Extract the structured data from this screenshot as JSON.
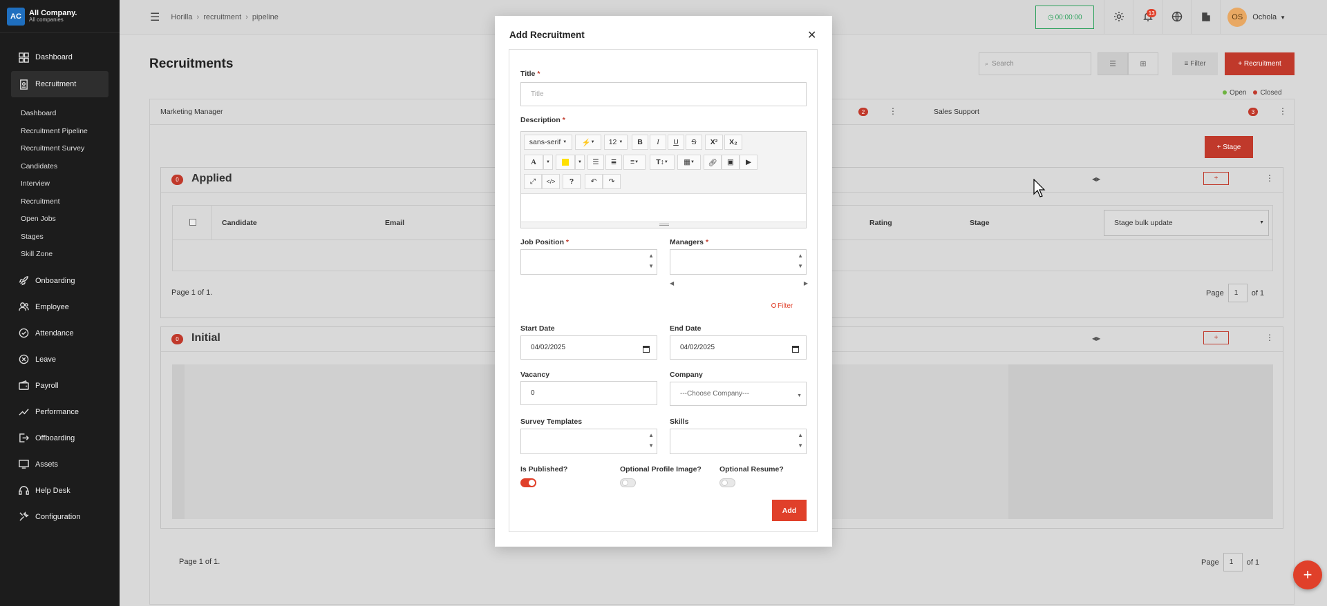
{
  "brand": {
    "initials": "AC",
    "name": "All Company.",
    "sub": "All companies"
  },
  "sidebar": {
    "items": [
      {
        "label": "Dashboard",
        "icon": "dashboard-icon"
      },
      {
        "label": "Recruitment",
        "icon": "recruitment-icon"
      },
      {
        "label": "Onboarding",
        "icon": "rocket-icon"
      },
      {
        "label": "Employee",
        "icon": "people-icon"
      },
      {
        "label": "Attendance",
        "icon": "check-circle-icon"
      },
      {
        "label": "Leave",
        "icon": "leave-icon"
      },
      {
        "label": "Payroll",
        "icon": "wallet-icon"
      },
      {
        "label": "Performance",
        "icon": "chart-line-icon"
      },
      {
        "label": "Offboarding",
        "icon": "exit-icon"
      },
      {
        "label": "Assets",
        "icon": "monitor-icon"
      },
      {
        "label": "Help Desk",
        "icon": "headset-icon"
      },
      {
        "label": "Configuration",
        "icon": "wrench-icon"
      }
    ],
    "subitems": [
      "Dashboard",
      "Recruitment Pipeline",
      "Recruitment Survey",
      "Candidates",
      "Interview",
      "Recruitment",
      "Open Jobs",
      "Stages",
      "Skill Zone"
    ]
  },
  "topbar": {
    "breadcrumb": [
      "Horilla",
      "recruitment",
      "pipeline"
    ],
    "timer": "00:00:00",
    "notifications": "13",
    "user_initials": "OS",
    "user_name": "Ochola"
  },
  "page": {
    "title": "Recruitments",
    "search_placeholder": "Search",
    "filter_label": "Filter",
    "add_recruitment_label": "+ Recruitment",
    "legend_open": "Open",
    "legend_closed": "Closed",
    "open_color": "#6db33f",
    "closed_color": "#c0392b",
    "tabs": [
      {
        "label": "Marketing Manager"
      },
      {
        "label": "",
        "count": "2"
      },
      {
        "label": "Sales Support",
        "count": "3"
      }
    ],
    "stage_button": "+ Stage",
    "stages": [
      {
        "name": "Applied",
        "count": "0",
        "add": "+"
      },
      {
        "name": "Initial",
        "count": "0",
        "add": "+"
      }
    ],
    "table_headers": [
      "Candidate",
      "Email",
      "Rating",
      "Stage"
    ],
    "bulk_update": "Stage bulk update",
    "pager": {
      "text": "Page 1 of 1.",
      "page_label": "Page",
      "page_value": "1",
      "of_label": "of 1"
    }
  },
  "modal": {
    "title": "Add Recruitment",
    "title_label": "Title",
    "title_placeholder": "Title",
    "description_label": "Description",
    "font_name": "sans-serif",
    "font_size": "12",
    "job_position_label": "Job Position",
    "managers_label": "Managers",
    "filter_label": "Filter",
    "start_date_label": "Start Date",
    "start_date": "04/02/2025",
    "end_date_label": "End Date",
    "end_date": "04/02/2025",
    "vacancy_label": "Vacancy",
    "vacancy": "0",
    "company_label": "Company",
    "company_value": "---Choose Company---",
    "survey_label": "Survey Templates",
    "skills_label": "Skills",
    "published_label": "Is Published?",
    "profile_label": "Optional Profile Image?",
    "resume_label": "Optional Resume?",
    "published": true,
    "optional_profile": false,
    "optional_resume": false,
    "add_label": "Add"
  }
}
